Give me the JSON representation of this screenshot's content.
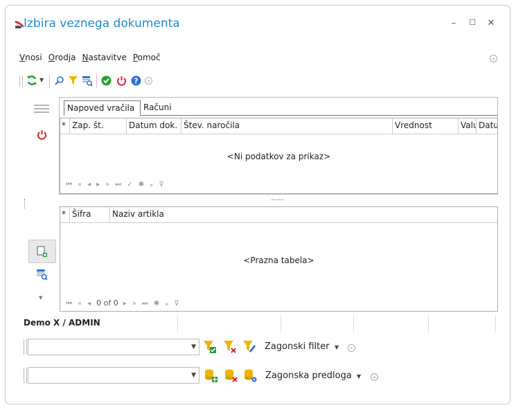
{
  "window": {
    "title": "Izbira veznega dokumenta",
    "minimize": "–",
    "maximize": "☐",
    "close": "✕"
  },
  "menu": {
    "items": [
      {
        "first": "V",
        "rest": "nosi"
      },
      {
        "first": "O",
        "rest": "rodja"
      },
      {
        "first": "N",
        "rest": "astavitve"
      },
      {
        "first": "P",
        "rest": "omoč"
      }
    ]
  },
  "tabs": [
    {
      "label": "Napoved vračila"
    },
    {
      "label": "Računi"
    }
  ],
  "top_grid": {
    "columns": [
      {
        "label": "*"
      },
      {
        "label": "Zap. št."
      },
      {
        "label": "Datum dok."
      },
      {
        "label": "Štev. naročila"
      },
      {
        "label": "Vrednost"
      },
      {
        "label": "Valu"
      },
      {
        "label": "Datu"
      }
    ],
    "empty_text": "<Ni podatkov za prikaz>"
  },
  "bottom_grid": {
    "columns": [
      {
        "label": "*"
      },
      {
        "label": "Šifra"
      },
      {
        "label": "Naziv artikla"
      }
    ],
    "empty_text": "<Prazna tabela>",
    "record_info": "0 of 0"
  },
  "status": {
    "user": "Demo X / ADMIN"
  },
  "filter": {
    "label": "Zagonski filter",
    "value": ""
  },
  "template": {
    "label": "Zagonska predloga",
    "value": ""
  },
  "colors": {
    "accent": "#1e8ad6",
    "green": "#2a9d3a",
    "red": "#d9232e",
    "blue": "#2d6fd6",
    "yellow": "#f0b400"
  }
}
